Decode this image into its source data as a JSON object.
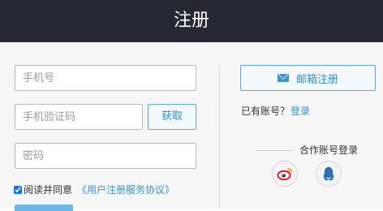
{
  "header": {
    "title": "注册"
  },
  "form": {
    "phone": {
      "placeholder": "手机号",
      "value": ""
    },
    "code": {
      "placeholder": "手机验证码",
      "value": ""
    },
    "get_code_label": "获取",
    "password": {
      "placeholder": "密码",
      "value": ""
    },
    "agree": {
      "checked": true,
      "text": "阅读并同意",
      "link": "《用户注册服务协议》"
    }
  },
  "side": {
    "email_register_label": "邮箱注册",
    "have_account_text": "已有账号？",
    "login_link": "登录",
    "partner_title": "合作账号登录",
    "partners": [
      {
        "icon": "weibo-icon"
      },
      {
        "icon": "qq-icon"
      }
    ]
  },
  "colors": {
    "header_bg": "#252733",
    "accent": "#3a95d3",
    "weibo_red": "#e6162d",
    "qq_blue": "#2b6fb3"
  }
}
